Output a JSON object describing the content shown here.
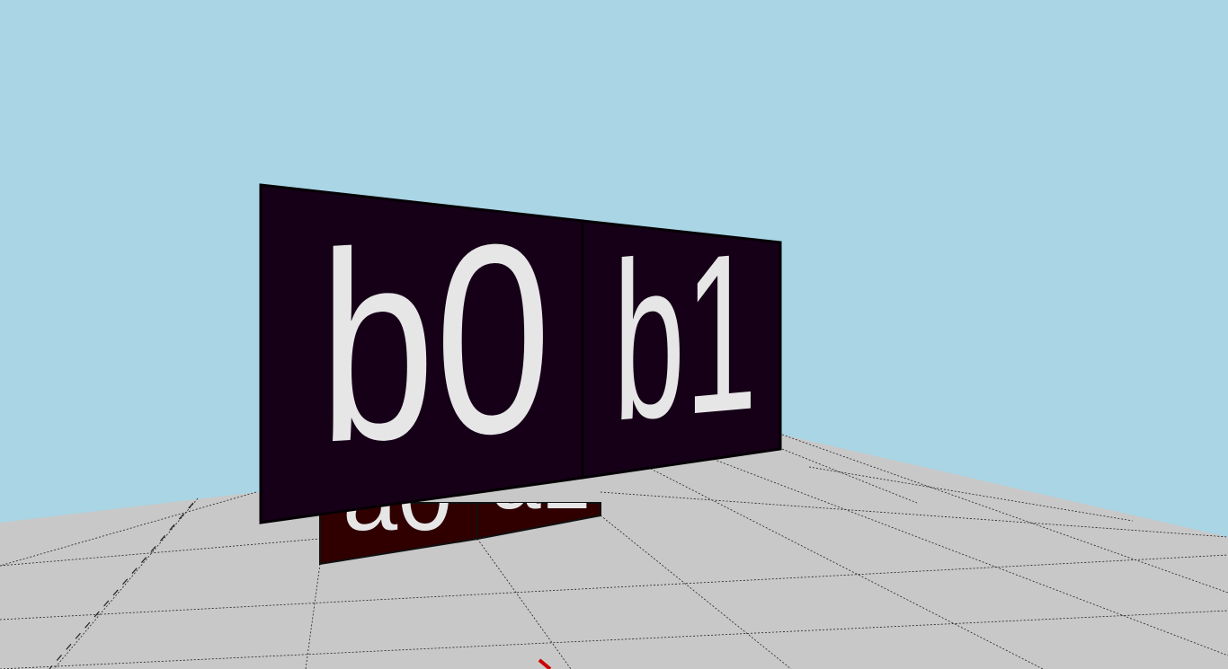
{
  "scene": {
    "sky_color": "#a9d5e5",
    "floor_color": "#c8c8c8",
    "grid_line_color": "#222222",
    "axis_marker_color": "#cc0000"
  },
  "panels": {
    "back_row": {
      "color": "#300000",
      "label_color": "#e6e6e6",
      "items": [
        {
          "label": "a0"
        },
        {
          "label": "a1"
        }
      ]
    },
    "front_row": {
      "color": "#160018",
      "label_color": "#e6e6e6",
      "items": [
        {
          "label": "b0"
        },
        {
          "label": "b1"
        }
      ]
    }
  }
}
